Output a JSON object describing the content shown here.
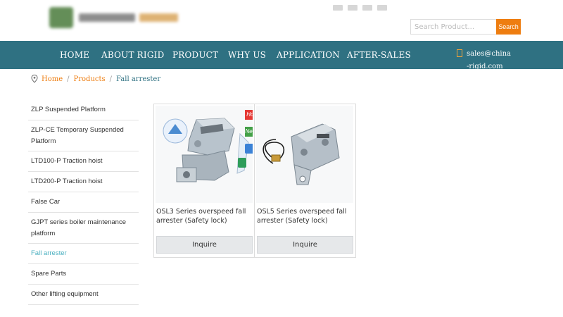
{
  "header": {
    "search_placeholder": "Search Product...",
    "search_button": "Search"
  },
  "nav": {
    "items": [
      "HOME",
      "ABOUT RIGID",
      "PRODUCT",
      "WHY US",
      "APPLICATION",
      "AFTER-SALES"
    ],
    "email": "sales@china-rigid.com"
  },
  "breadcrumb": {
    "home": "Home",
    "products": "Products",
    "current": "Fall arrester",
    "separator": "/"
  },
  "sidebar": {
    "items": [
      "ZLP Suspended Platform",
      "ZLP-CE Temporary Suspended Platform",
      "LTD100-P Traction hoist",
      "LTD200-P Traction hoist",
      "False Car",
      "GJPT series boiler maintenance platform",
      "Fall arrester",
      "Spare Parts",
      "Other lifting equipment"
    ],
    "active_index": 6
  },
  "products": [
    {
      "name": "OSL3 Series overspeed fall arrester (Safety lock)",
      "button": "Inquire",
      "badges": [
        "Hot",
        "New"
      ]
    },
    {
      "name": "OSL5 Series overspeed fall arrester (Safety lock)",
      "button": "Inquire"
    }
  ],
  "colors": {
    "nav_bg": "#2f7182",
    "accent": "#ee7d10",
    "active_link": "#4bb0c0",
    "badge_hot": "#e53935",
    "badge_new": "#43a047"
  }
}
